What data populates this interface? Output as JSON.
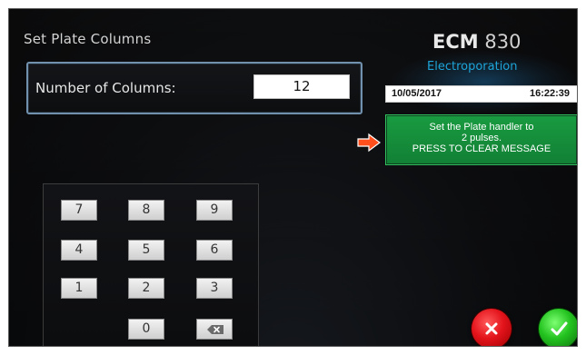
{
  "screen": {
    "title": "Set Plate Columns"
  },
  "field": {
    "label": "Number of Columns:",
    "value": "12"
  },
  "brand": {
    "model_bold": "ECM",
    "model_number": "830",
    "subtitle": "Electroporation"
  },
  "status": {
    "date": "10/05/2017",
    "time": "16:22:39"
  },
  "message": {
    "line1": "Set the Plate handler to",
    "line2": "2 pulses.",
    "line3": "PRESS TO CLEAR MESSAGE",
    "arrow_icon": "right-arrow-icon"
  },
  "keypad": {
    "keys": [
      "7",
      "8",
      "9",
      "4",
      "5",
      "6",
      "1",
      "2",
      "3",
      "0"
    ],
    "backspace_icon": "backspace-icon"
  },
  "actions": {
    "cancel_icon": "close-icon",
    "confirm_icon": "check-icon"
  },
  "colors": {
    "accent_blue": "#1aa3d8",
    "message_green": "#169a3e",
    "cancel_red": "#e3131b",
    "confirm_green": "#23c21f"
  }
}
